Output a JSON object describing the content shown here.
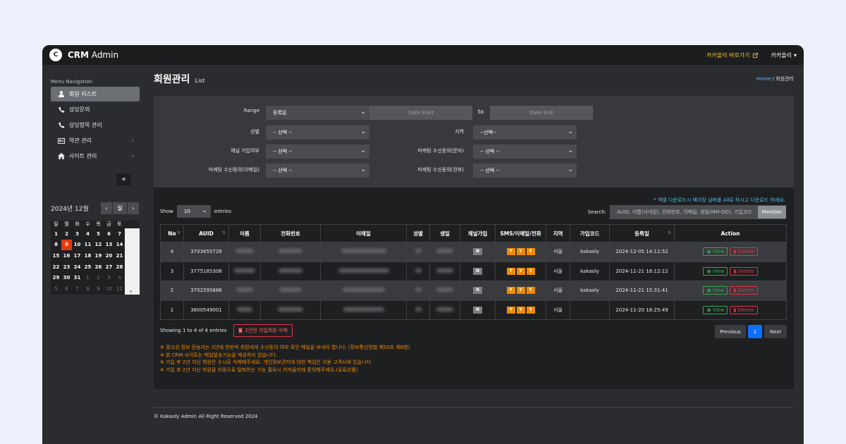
{
  "app": {
    "logo_letter": "C",
    "brand_bold": "CRM",
    "brand_rest": " Admin"
  },
  "topbar": {
    "kakao_link": "카카올리 바로가기",
    "user": "카카올리"
  },
  "sidebar": {
    "title": "Menu Navigation",
    "items": [
      {
        "label": "회원 리스트",
        "icon": "user-icon"
      },
      {
        "label": "상담문의",
        "icon": "phone-icon"
      },
      {
        "label": "상담항목 관리",
        "icon": "phone-icon"
      },
      {
        "label": "약관 관리",
        "icon": "card-icon"
      },
      {
        "label": "사이트 관리",
        "icon": "home-icon"
      }
    ],
    "collapse": "«"
  },
  "calendar": {
    "title": "2024년 12월",
    "prev": "‹",
    "month_btn": "월",
    "next": "›",
    "dow": [
      "일",
      "월",
      "화",
      "수",
      "목",
      "금",
      "토"
    ],
    "days": [
      [
        "1",
        "2",
        "3",
        "4",
        "5",
        "6",
        "7"
      ],
      [
        "8",
        "9",
        "10",
        "11",
        "12",
        "13",
        "14"
      ],
      [
        "15",
        "16",
        "17",
        "18",
        "19",
        "20",
        "21"
      ],
      [
        "22",
        "23",
        "24",
        "25",
        "26",
        "27",
        "28"
      ],
      [
        "29",
        "30",
        "31",
        "1",
        "2",
        "3",
        "4"
      ],
      [
        "5",
        "6",
        "7",
        "8",
        "9",
        "10",
        "11"
      ]
    ],
    "today": "9"
  },
  "page": {
    "title": "회원관리",
    "subtitle": "List",
    "breadcrumb_home": "Home",
    "breadcrumb_sep": "/",
    "breadcrumb_current": "회원관리"
  },
  "filters": {
    "range_label": "Range",
    "range_value": "등록일",
    "date_start": "Date Start",
    "to": "to",
    "date_end": "Date End",
    "gender_label": "성별",
    "gender_value": "-- 선택 --",
    "region_label": "지역",
    "region_value": "--선택--",
    "channel_label": "채널 가입여부",
    "channel_value": "-- 선택 --",
    "mkt_text_label": "마케팅 수신동의(문자)",
    "mkt_text_value": "-- 선택 --",
    "mkt_email_label": "마케팅 수신동의(이메일)",
    "mkt_email_value": "-- 선택 --",
    "mkt_phone_label": "마케팅 수신동의(전화)",
    "mkt_phone_value": "-- 선택 --"
  },
  "table_ctrl": {
    "notice": "* 엑셀 다운로드시 페이징 넘버를 All로 하시고 다운로드 하세요.",
    "show": "Show",
    "length": "10",
    "entries": "entries",
    "search_label": "Search:",
    "search_placeholder": "AUID, 이름(닉네임), 전화번호, 이메일, 생일(MM-DD), 가입코드",
    "member_btn": "Member"
  },
  "table": {
    "headers": [
      "No",
      "AUID",
      "이름",
      "전화번호",
      "이메일",
      "성별",
      "생일",
      "채널가입",
      "SMS/이메일/전화",
      "지역",
      "가입코드",
      "등록일",
      "Action"
    ],
    "rows": [
      {
        "no": "4",
        "auid": "3703655728",
        "channel": "N",
        "sms": "Y",
        "email": "Y",
        "phone": "Y",
        "region": "서울",
        "code": "kakaoly",
        "date": "2024-12-05 14:11:52"
      },
      {
        "no": "3",
        "auid": "3775185308",
        "channel": "N",
        "sms": "Y",
        "email": "Y",
        "phone": "Y",
        "region": "서울",
        "code": "kakaoly",
        "date": "2024-11-21 16:12:12"
      },
      {
        "no": "2",
        "auid": "3702595886",
        "channel": "N",
        "sms": "Y",
        "email": "Y",
        "phone": "Y",
        "region": "서울",
        "code": "kakaoly",
        "date": "2024-11-21 15:31:41"
      },
      {
        "no": "1",
        "auid": "3800549001",
        "channel": "N",
        "sms": "Y",
        "email": "Y",
        "phone": "Y",
        "region": "서울",
        "code": "",
        "date": "2024-11-20 18:25:49"
      }
    ],
    "view": "View",
    "delete": "Delete"
  },
  "footer_info": {
    "showing": "Showing 1 to 4 of 4 entries",
    "delete_old": "2년전 가입회원 삭제",
    "prev": "Previous",
    "page": "1",
    "next": "Next"
  },
  "notes": [
    "※ 광고성 정보 전송자는 2년에 한번씩 회원에게 수신동의 여부 확인 메일을 보내야 합니다. (정보통신망법 제50조 제8항)",
    "※ 본 CRM 사이트는 메일발송기능을 제공하지 않습니다.",
    "※ 가입 후 2년 지난 회원은 수시로 삭제해주세요. 개인정보관리에 대한 책임은 이용 고객사에 있습니다.",
    "※ 가입 후 2년 지난 회원을 자동으로 탈퇴하는 기능 필요시 카카올리에 문의해주세요.(유료상품)"
  ],
  "copyright": "© Kakaoly Admin All Right Reserved 2024",
  "colors": {
    "accent": "#0d6efd",
    "orange": "#f08a00",
    "today": "#e8380d",
    "view": "#2fa84f",
    "delete": "#dc3545"
  }
}
